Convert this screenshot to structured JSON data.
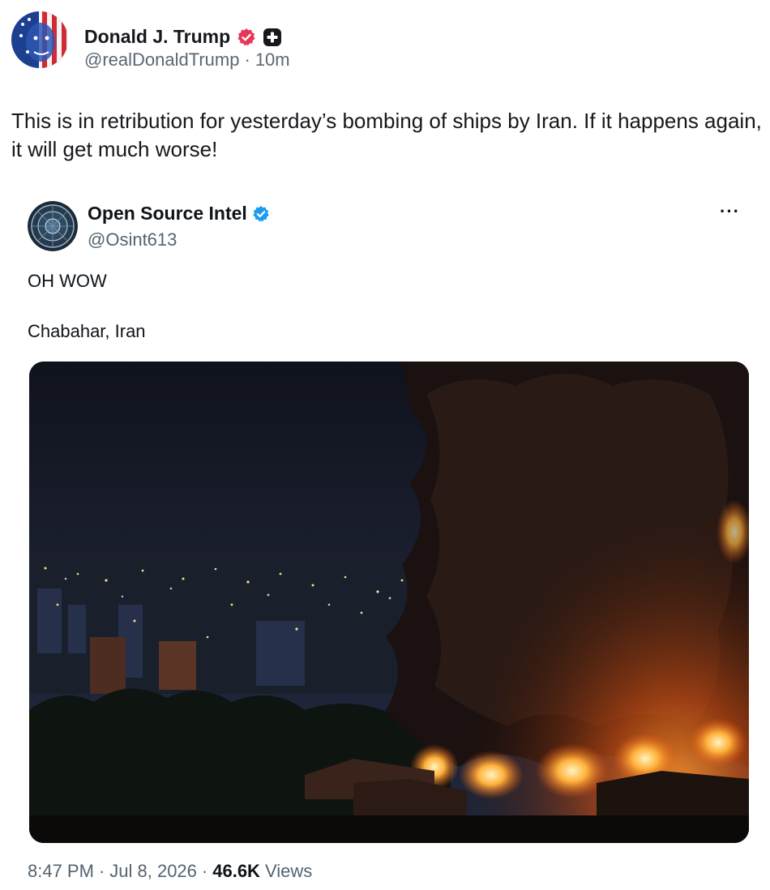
{
  "post": {
    "author_name": "Donald J. Trump",
    "author_handle": "@realDonaldTrump",
    "separator": "·",
    "time_ago": "10m",
    "text": "This is in retribution for yesterday’s bombing of ships by Iran. If it happens again, it will get much worse!"
  },
  "quote": {
    "author_name": "Open Source Intel",
    "author_handle": "@Osint613",
    "more_label": "···",
    "line1": "OH WOW",
    "line2": "Chabahar, Iran",
    "time": "8:47 PM",
    "date": "Jul 8, 2026",
    "views_count": "46.6K",
    "views_label": "Views",
    "separator": "·"
  },
  "colors": {
    "truth_badge": "#e8355a",
    "verified_blue": "#1d9bf0",
    "secondary_text": "#536471"
  },
  "icons": {
    "truth_badge": "verified-badge-icon",
    "plus_badge": "plus-icon",
    "quote_verified": "verified-check-icon",
    "more": "more-options-icon"
  }
}
